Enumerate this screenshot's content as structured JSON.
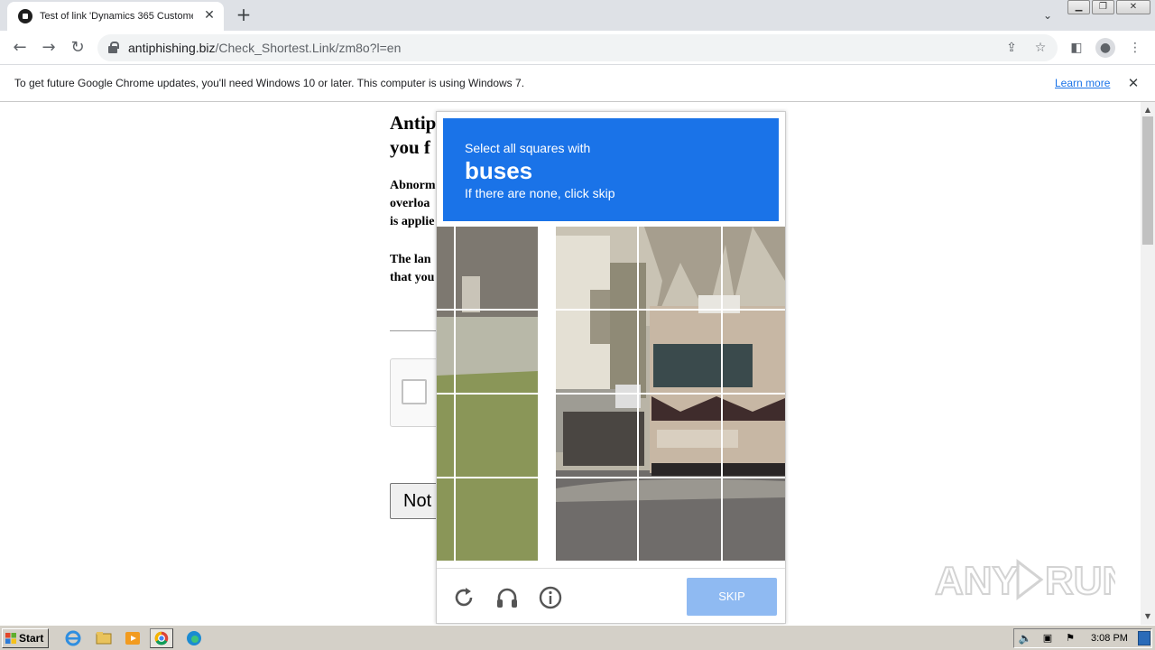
{
  "browser": {
    "tab": {
      "title": "Test of link 'Dynamics 365 Customer"
    },
    "url": {
      "host": "antiphishing.biz",
      "path": "/Check_Shortest.Link/zm8o?l=en"
    }
  },
  "infobar": {
    "message": "To get future Google Chrome updates, you'll need Windows 10 or later. This computer is using Windows 7.",
    "link": "Learn more"
  },
  "page": {
    "title_line1": "Antip",
    "title_line2": "you f",
    "para1": [
      "Abnorm",
      "overloa",
      "is applie"
    ],
    "para2": [
      "The lan",
      "that you"
    ],
    "button_label": "Not"
  },
  "challenge": {
    "instruction": "Select all squares with",
    "target": "buses",
    "hint": "If there are none, click skip",
    "skip_label": "SKIP",
    "accent_color": "#1a73e8"
  },
  "taskbar": {
    "start_label": "Start",
    "clock": "3:08 PM"
  },
  "watermark": "ANY RUN"
}
